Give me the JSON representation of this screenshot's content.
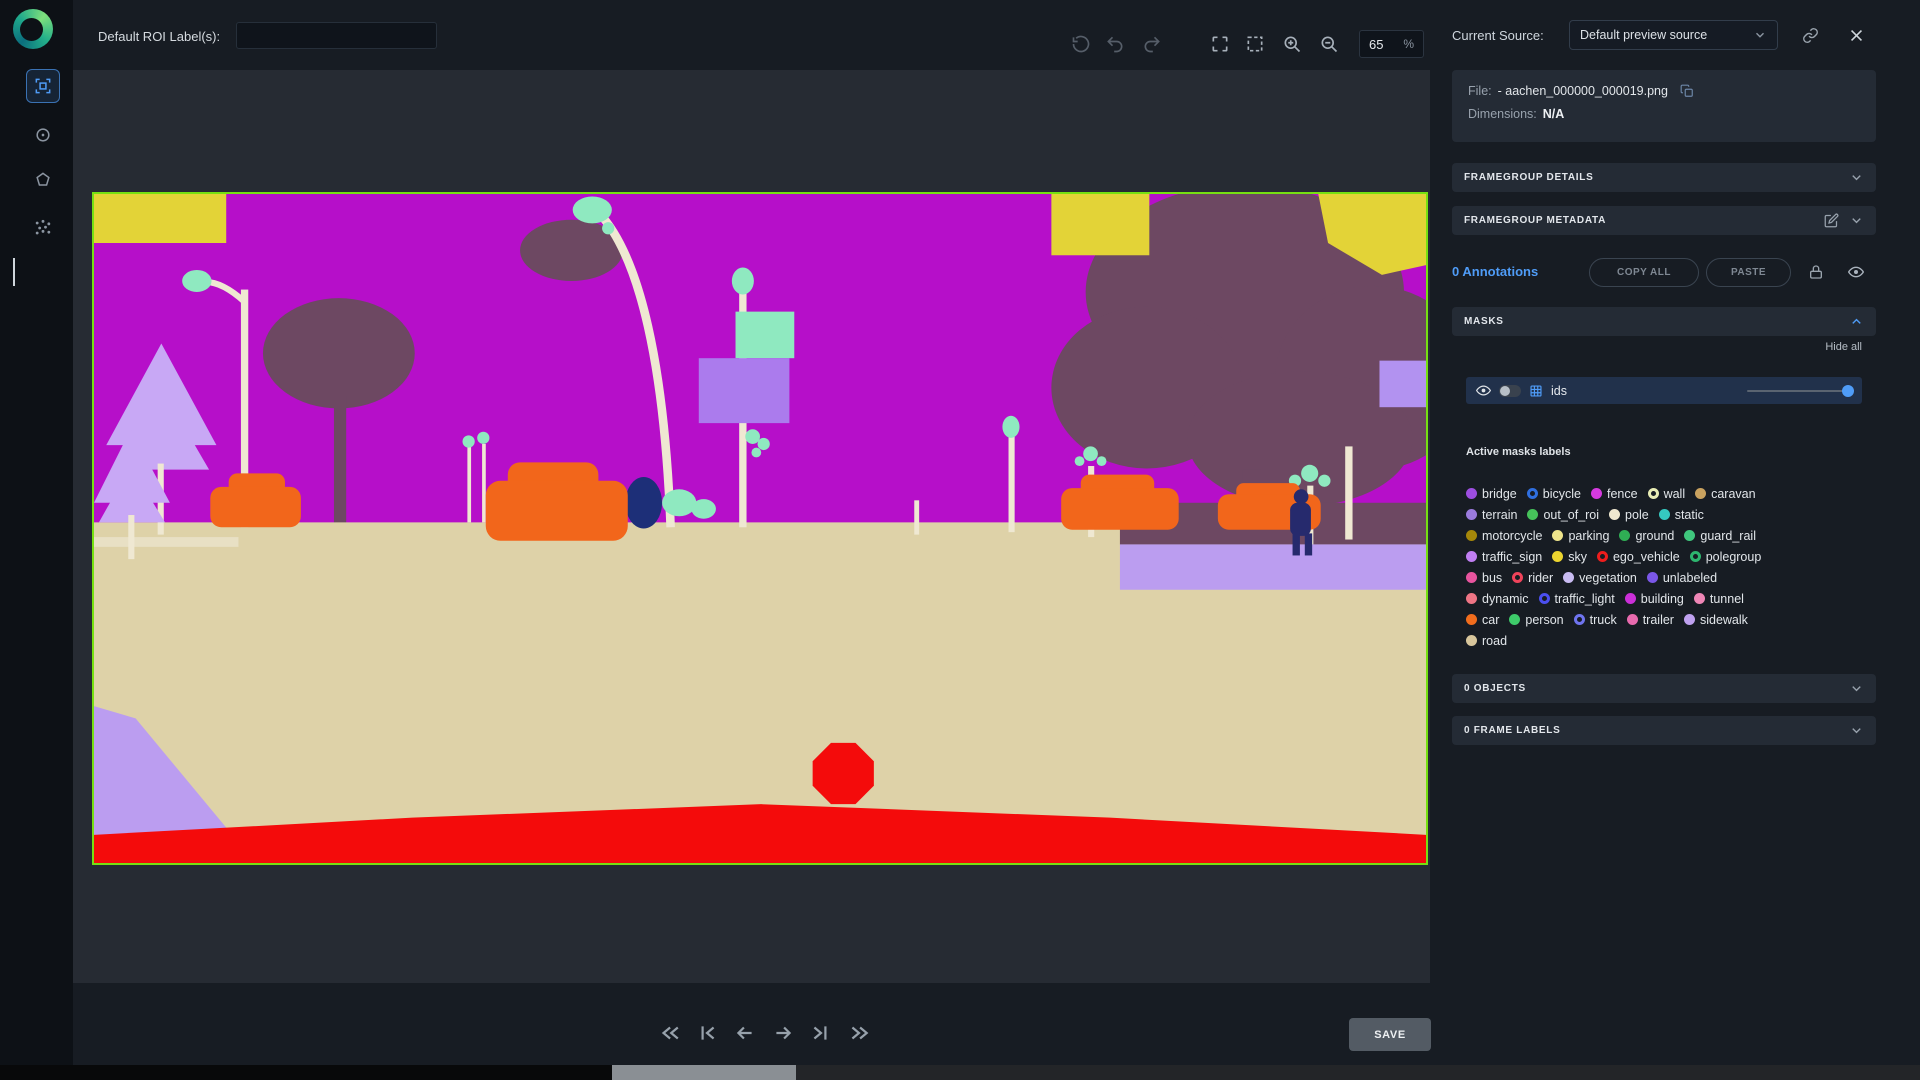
{
  "colors": {
    "accent": "#4f9cf7",
    "roi_border": "#76e012",
    "save_bg": "#535b64"
  },
  "topbar": {
    "roi_label": "Default ROI Label(s):",
    "roi_value": "",
    "zoom_value": "65",
    "zoom_unit": "%"
  },
  "source_bar": {
    "label": "Current Source:",
    "selected": "Default preview source"
  },
  "file_info": {
    "file_label": "File:",
    "file_name": "- aachen_000000_000019.png",
    "dimensions_label": "Dimensions:",
    "dimensions_value": "N/A"
  },
  "sections": {
    "framegroup_details": "FRAMEGROUP DETAILS",
    "framegroup_metadata": "FRAMEGROUP METADATA",
    "objects": "0 OBJECTS",
    "frame_labels": "0 FRAME LABELS"
  },
  "annotations": {
    "count_label": "0 Annotations",
    "copy_all": "COPY ALL",
    "paste": "PASTE"
  },
  "masks": {
    "header": "MASKS",
    "hide_all": "Hide all",
    "ids_label": "ids",
    "active_title": "Active masks labels",
    "chip_rows": [
      [
        {
          "label": "bridge",
          "color": "#9d4ee0",
          "style": "fill"
        },
        {
          "label": "bicycle",
          "color": "#2f6fe0",
          "style": "ring"
        },
        {
          "label": "fence",
          "color": "#d63ae0",
          "style": "fill"
        },
        {
          "label": "wall",
          "color": "#e8ecb4",
          "style": "ring"
        },
        {
          "label": "caravan",
          "color": "#c9a25f",
          "style": "fill"
        }
      ],
      [
        {
          "label": "terrain",
          "color": "#9b7bdd",
          "style": "fill"
        },
        {
          "label": "out_of_roi",
          "color": "#46c25a",
          "style": "fill"
        },
        {
          "label": "pole",
          "color": "#efe8cf",
          "style": "fill"
        },
        {
          "label": "static",
          "color": "#35c8c0",
          "style": "fill"
        }
      ],
      [
        {
          "label": "motorcycle",
          "color": "#a5870a",
          "style": "fill"
        },
        {
          "label": "parking",
          "color": "#eee48b",
          "style": "fill"
        },
        {
          "label": "ground",
          "color": "#2fae54",
          "style": "fill"
        },
        {
          "label": "guard_rail",
          "color": "#3fc77d",
          "style": "fill"
        }
      ],
      [
        {
          "label": "traffic_sign",
          "color": "#c07ef2",
          "style": "fill"
        },
        {
          "label": "sky",
          "color": "#edd52f",
          "style": "fill"
        },
        {
          "label": "ego_vehicle",
          "color": "#ee1d1d",
          "style": "ring"
        },
        {
          "label": "polegroup",
          "color": "#2db56e",
          "style": "ring"
        }
      ],
      [
        {
          "label": "bus",
          "color": "#e8549e",
          "style": "fill"
        },
        {
          "label": "rider",
          "color": "#f0435a",
          "style": "ring"
        },
        {
          "label": "vegetation",
          "color": "#c9bcf2",
          "style": "fill"
        },
        {
          "label": "unlabeled",
          "color": "#7b57e8",
          "style": "fill"
        }
      ],
      [
        {
          "label": "dynamic",
          "color": "#ef7585",
          "style": "fill"
        },
        {
          "label": "traffic_light",
          "color": "#4b4ff0",
          "style": "ring"
        },
        {
          "label": "building",
          "color": "#cb2fd8",
          "style": "fill"
        },
        {
          "label": "tunnel",
          "color": "#ef86b6",
          "style": "fill"
        }
      ],
      [
        {
          "label": "car",
          "color": "#f26d1d",
          "style": "fill"
        },
        {
          "label": "person",
          "color": "#3ecb6a",
          "style": "fill"
        },
        {
          "label": "truck",
          "color": "#6f74ef",
          "style": "ring"
        },
        {
          "label": "trailer",
          "color": "#e86aae",
          "style": "fill"
        },
        {
          "label": "sidewalk",
          "color": "#bfa1ef",
          "style": "fill"
        }
      ],
      [
        {
          "label": "road",
          "color": "#d8c69c",
          "style": "fill"
        }
      ]
    ]
  },
  "save_label": "SAVE"
}
